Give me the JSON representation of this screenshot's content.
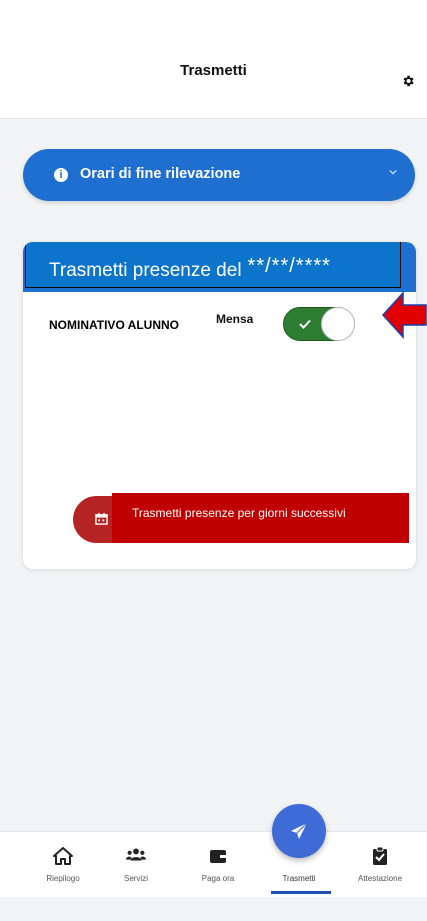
{
  "header": {
    "title": "Trasmetti",
    "settings_icon": "gear-icon"
  },
  "accordion": {
    "label": "Orari di fine rilevazione",
    "icon": "info-icon",
    "chevron": "chevron-down-icon"
  },
  "card": {
    "title": "Trasmetti presenze del",
    "date_mask": "**/**/****",
    "student_label": "NOMINATIVO ALUNNO",
    "service_label": "Mensa",
    "toggle_on": true
  },
  "action": {
    "label": "Trasmetti presenze per giorni successivi",
    "icon": "calendar-icon"
  },
  "bottom_nav": {
    "items": [
      {
        "label": "Riepilogo",
        "icon": "home-icon"
      },
      {
        "label": "Servizi",
        "icon": "users-icon"
      },
      {
        "label": "Paga ora",
        "icon": "wallet-icon"
      },
      {
        "label": "Trasmetti",
        "icon": "send-icon",
        "active": true
      },
      {
        "label": "Attestazione",
        "icon": "clipboard-check-icon"
      }
    ]
  },
  "colors": {
    "primary": "#1f6fd1",
    "toggle": "#2e7d32",
    "action_red": "#c00000",
    "arrow_red": "#e00000"
  }
}
